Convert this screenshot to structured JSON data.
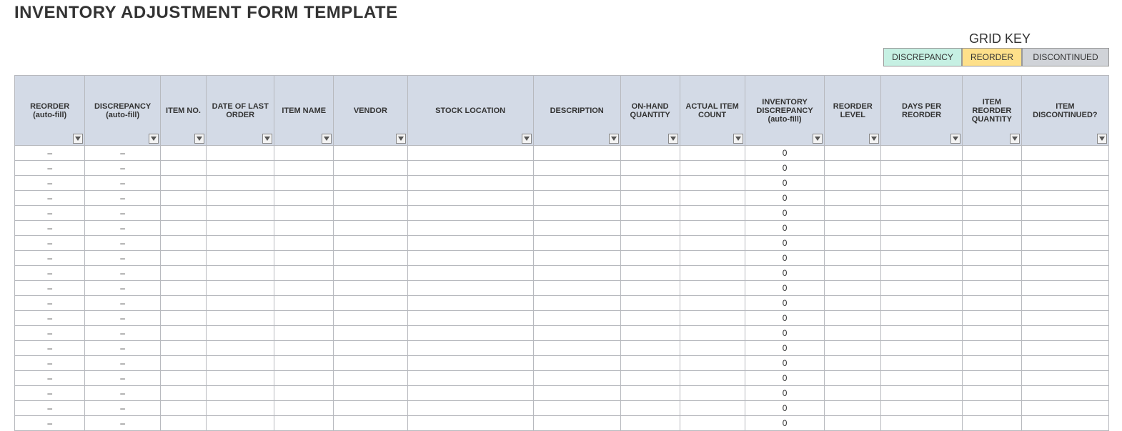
{
  "title": "INVENTORY ADJUSTMENT FORM TEMPLATE",
  "legend": {
    "title": "GRID KEY",
    "items": {
      "discrepancy": "DISCREPANCY",
      "reorder": "REORDER",
      "discontinued": "DISCONTINUED"
    }
  },
  "columns": [
    "REORDER (auto-fill)",
    "DISCREPANCY (auto-fill)",
    "ITEM NO.",
    "DATE OF LAST ORDER",
    "ITEM NAME",
    "VENDOR",
    "STOCK LOCATION",
    "DESCRIPTION",
    "ON-HAND QUANTITY",
    "ACTUAL ITEM COUNT",
    "INVENTORY DISCREPANCY (auto-fill)",
    "REORDER LEVEL",
    "DAYS PER REORDER",
    "ITEM REORDER QUANTITY",
    "ITEM DISCONTINUED?"
  ],
  "rows": [
    {
      "reorder": "–",
      "discrepancy": "–",
      "inv_discrepancy": "0"
    },
    {
      "reorder": "–",
      "discrepancy": "–",
      "inv_discrepancy": "0"
    },
    {
      "reorder": "–",
      "discrepancy": "–",
      "inv_discrepancy": "0"
    },
    {
      "reorder": "–",
      "discrepancy": "–",
      "inv_discrepancy": "0"
    },
    {
      "reorder": "–",
      "discrepancy": "–",
      "inv_discrepancy": "0"
    },
    {
      "reorder": "–",
      "discrepancy": "–",
      "inv_discrepancy": "0"
    },
    {
      "reorder": "–",
      "discrepancy": "–",
      "inv_discrepancy": "0"
    },
    {
      "reorder": "–",
      "discrepancy": "–",
      "inv_discrepancy": "0"
    },
    {
      "reorder": "–",
      "discrepancy": "–",
      "inv_discrepancy": "0"
    },
    {
      "reorder": "–",
      "discrepancy": "–",
      "inv_discrepancy": "0"
    },
    {
      "reorder": "–",
      "discrepancy": "–",
      "inv_discrepancy": "0"
    },
    {
      "reorder": "–",
      "discrepancy": "–",
      "inv_discrepancy": "0"
    },
    {
      "reorder": "–",
      "discrepancy": "–",
      "inv_discrepancy": "0"
    },
    {
      "reorder": "–",
      "discrepancy": "–",
      "inv_discrepancy": "0"
    },
    {
      "reorder": "–",
      "discrepancy": "–",
      "inv_discrepancy": "0"
    },
    {
      "reorder": "–",
      "discrepancy": "–",
      "inv_discrepancy": "0"
    },
    {
      "reorder": "–",
      "discrepancy": "–",
      "inv_discrepancy": "0"
    },
    {
      "reorder": "–",
      "discrepancy": "–",
      "inv_discrepancy": "0"
    },
    {
      "reorder": "–",
      "discrepancy": "–",
      "inv_discrepancy": "0"
    }
  ]
}
